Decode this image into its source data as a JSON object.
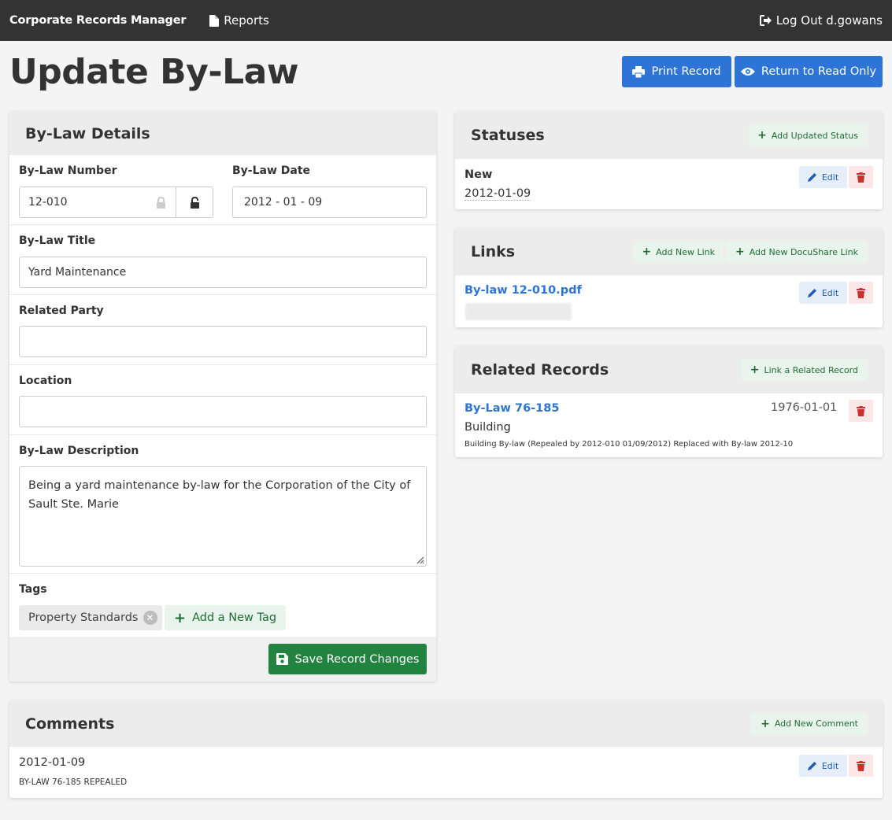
{
  "nav": {
    "brand": "Corporate Records Manager",
    "reports": "Reports",
    "logout": "Log Out d.gowans"
  },
  "header": {
    "title": "Update By-Law",
    "print": "Print Record",
    "readonly": "Return to Read Only"
  },
  "form": {
    "card_title": "By-Law Details",
    "number_label": "By-Law Number",
    "number_value": "12-010",
    "date_label": "By-Law Date",
    "date_value": "2012 - 01 - 09",
    "title_label": "By-Law Title",
    "title_value": "Yard Maintenance",
    "party_label": "Related Party",
    "party_value": "",
    "location_label": "Location",
    "location_value": "",
    "desc_label": "By-Law Description",
    "desc_value": "Being a yard maintenance by-law for the Corporation of the City of Sault Ste. Marie",
    "tags_label": "Tags",
    "tags": [
      "Property Standards"
    ],
    "add_tag": "Add a New Tag",
    "save": "Save Record Changes"
  },
  "statuses": {
    "title": "Statuses",
    "add": "Add Updated Status",
    "items": [
      {
        "name": "New",
        "date": "2012-01-09",
        "edit": "Edit"
      }
    ]
  },
  "links": {
    "title": "Links",
    "add": "Add New Link",
    "add_docushare": "Add New DocuShare Link",
    "items": [
      {
        "name": "By-law 12-010.pdf",
        "edit": "Edit"
      }
    ]
  },
  "related": {
    "title": "Related Records",
    "add": "Link a Related Record",
    "items": [
      {
        "name": "By-Law 76-185",
        "date": "1976-01-01",
        "category": "Building",
        "note": "Building By-law (Repealed by 2012-010 01/09/2012) Replaced with By-law 2012-10"
      }
    ]
  },
  "comments": {
    "title": "Comments",
    "add": "Add New Comment",
    "items": [
      {
        "date": "2012-01-09",
        "text": "BY-LAW 76-185 REPEALED",
        "edit": "Edit"
      }
    ]
  },
  "colors": {
    "navbar": "#333333",
    "primary": "#2d74d6",
    "success": "#22823f",
    "danger": "#c9302c"
  }
}
